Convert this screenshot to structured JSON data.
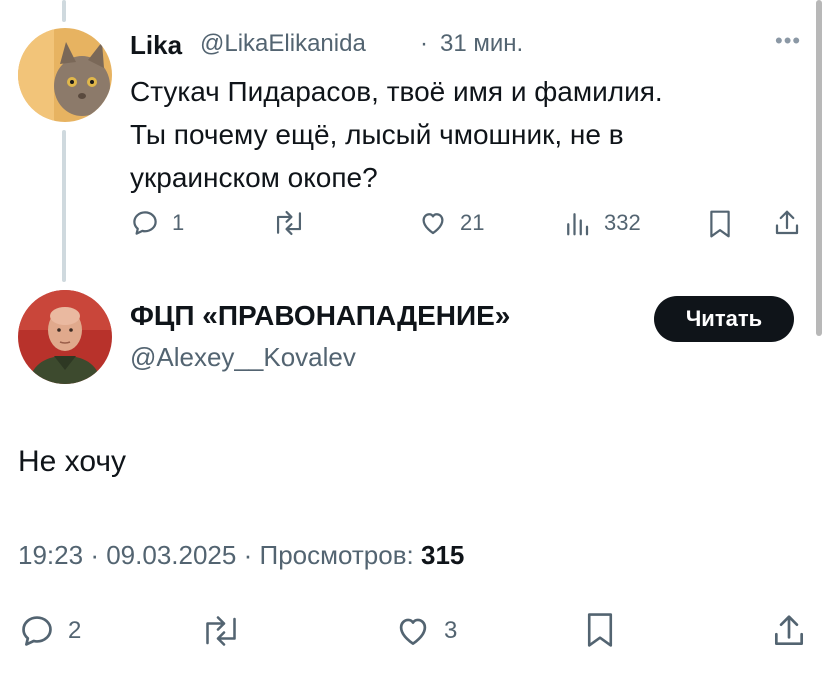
{
  "first_tweet": {
    "display_name": "Lika",
    "handle": "@LikaElikanida",
    "separator": "·",
    "time": "31 мин.",
    "more_icon": "more-horizontal-icon",
    "text_lines": [
      "Стукач Пидарасов, твоё имя и фамилия.",
      "Ты почему ещё, лысый чмошник, не в",
      "украинском окопе?"
    ],
    "actions": {
      "replies": "1",
      "retweets": "",
      "likes": "21",
      "views": "332"
    }
  },
  "main_tweet": {
    "display_name": "ФЦП «ПРАВОНАПАДЕНИЕ»",
    "handle": "@Alexey__Kovalev",
    "follow_label": "Читать",
    "text": "Не хочу",
    "time": "19:23",
    "separator": "·",
    "date": "09.03.2025",
    "views_label": "Просмотров:",
    "views_count": "315",
    "actions": {
      "replies": "2",
      "retweets": "",
      "likes": "3"
    }
  },
  "colors": {
    "text": "#0f1419",
    "secondary": "#536471",
    "follow_bg": "#0f1419",
    "thread_line": "#cfd9de"
  }
}
